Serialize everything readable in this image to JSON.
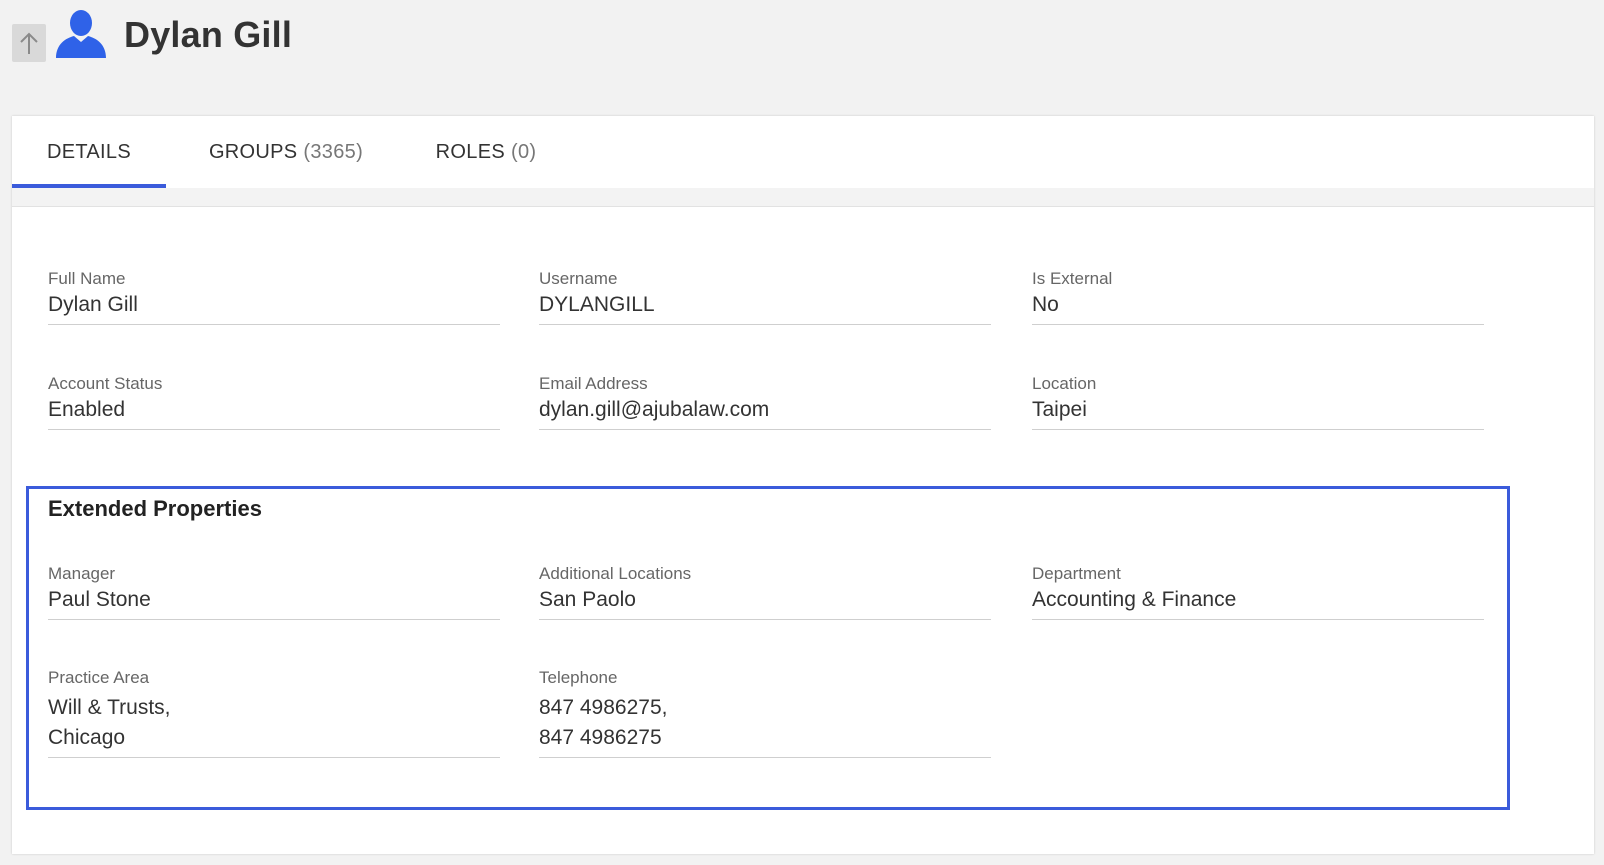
{
  "header": {
    "title": "Dylan Gill",
    "up_icon": "arrow-up-icon",
    "user_icon": "user-icon"
  },
  "tabs": [
    {
      "label": "DETAILS",
      "count": ""
    },
    {
      "label": "GROUPS",
      "count": "(3365)"
    },
    {
      "label": "ROLES",
      "count": "(0)"
    }
  ],
  "details": {
    "full_name": {
      "label": "Full Name",
      "value": "Dylan Gill"
    },
    "username": {
      "label": "Username",
      "value": "DYLANGILL"
    },
    "is_external": {
      "label": "Is External",
      "value": "No"
    },
    "account_status": {
      "label": "Account Status",
      "value": "Enabled"
    },
    "email": {
      "label": "Email Address",
      "value": "dylan.gill@ajubalaw.com"
    },
    "location": {
      "label": "Location",
      "value": "Taipei"
    }
  },
  "extended": {
    "title": "Extended Properties",
    "manager": {
      "label": "Manager",
      "value": "Paul Stone"
    },
    "additional_locations": {
      "label": "Additional Locations",
      "value": "San Paolo"
    },
    "department": {
      "label": "Department",
      "value": "Accounting & Finance"
    },
    "practice_area": {
      "label": "Practice Area",
      "value": "Will & Trusts,\nChicago"
    },
    "telephone": {
      "label": "Telephone",
      "value": "847 4986275,\n847 4986275"
    }
  },
  "colors": {
    "accent": "#3b5bdb",
    "icon_blue": "#2f62e8",
    "background": "#f2f2f2"
  }
}
